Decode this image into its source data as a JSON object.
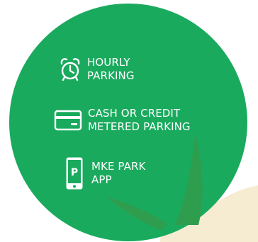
{
  "colors": {
    "circle_green": "#1aaa5e",
    "leaf_green": "#2f9d4e",
    "leaf_cream": "#f6ecd2",
    "icon_white": "#ffffff",
    "app_badge_green": "#1aaa5e"
  },
  "features": [
    {
      "icon": "alarm-clock-icon",
      "line1": "HOURLY",
      "line2": "PARKING"
    },
    {
      "icon": "credit-card-icon",
      "line1": "CASH OR CREDIT",
      "line2": "METERED PARKING"
    },
    {
      "icon": "smartphone-icon",
      "badge": "P",
      "line1": "MKE PARK",
      "line2": "APP"
    }
  ]
}
